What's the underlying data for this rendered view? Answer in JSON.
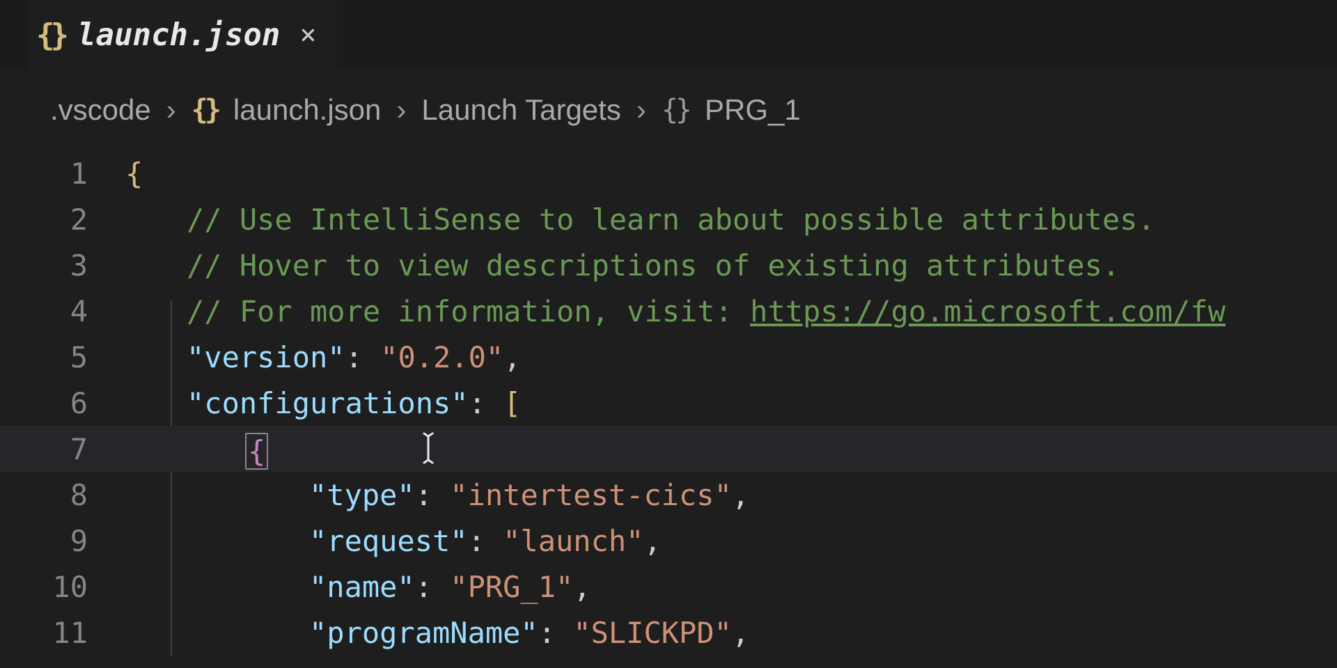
{
  "tab": {
    "icon": "{}",
    "filename": "launch.json"
  },
  "breadcrumbs": {
    "seg0": ".vscode",
    "seg1_icon": "{}",
    "seg1": "launch.json",
    "seg2": "Launch Targets",
    "seg3_icon": "{}",
    "seg3": "PRG_1"
  },
  "code": {
    "l1_open": "{",
    "l2": "// Use IntelliSense to learn about possible attributes.",
    "l3": "// Hover to view descriptions of existing attributes.",
    "l4_a": "// For more information, visit: ",
    "l4_b": "https://go.microsoft.com/fw",
    "l5_key": "\"version\"",
    "l5_val": "\"0.2.0\"",
    "l6_key": "\"configurations\"",
    "l6_br": "[",
    "l7_brace": "{",
    "l8_key": "\"type\"",
    "l8_val": "\"intertest-cics\"",
    "l9_key": "\"request\"",
    "l9_val": "\"launch\"",
    "l10_key": "\"name\"",
    "l10_val": "\"PRG_1\"",
    "l11_key": "\"programName\"",
    "l11_val": "\"SLICKPD\"",
    "colon": ": ",
    "comma": ","
  }
}
